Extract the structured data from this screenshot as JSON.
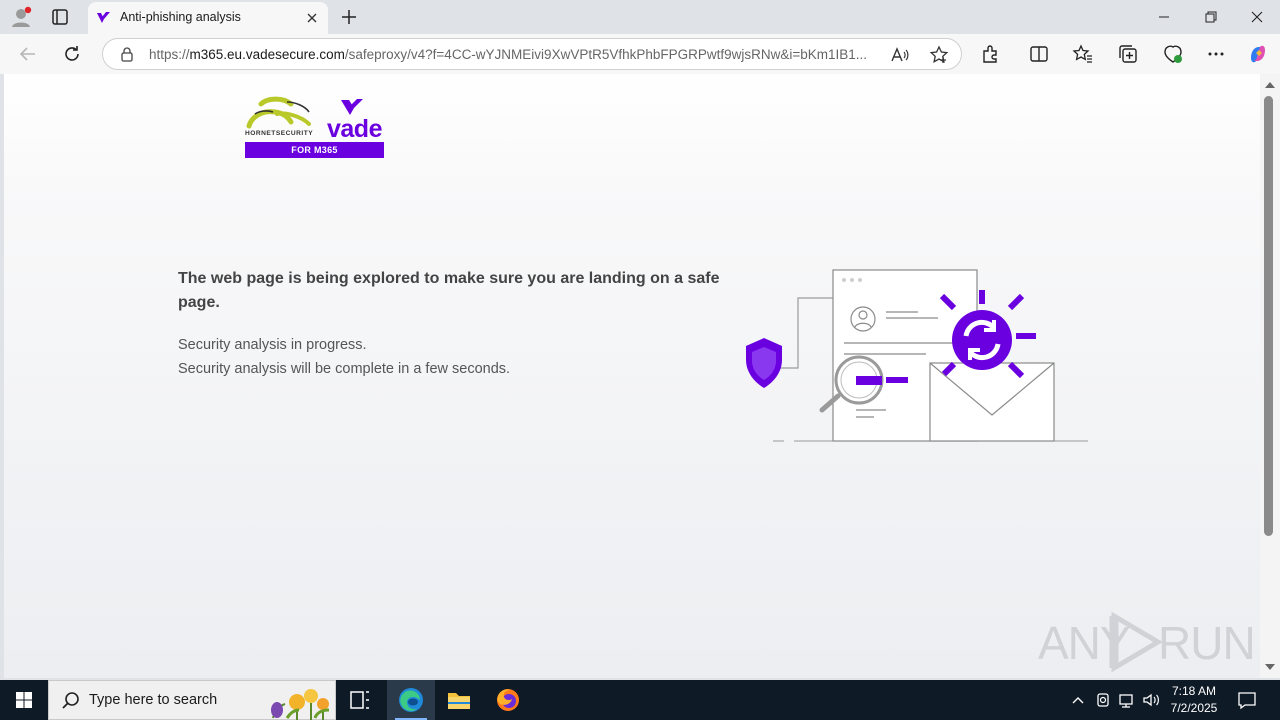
{
  "browser": {
    "tab": {
      "title": "Anti-phishing analysis"
    },
    "address": {
      "scheme": "https://",
      "host": "m365.eu.vadesecure.com",
      "rest": "/safeproxy/v4?f=4CC-wYJNMEivi9XwVPtR5VfhkPhbFPGRPwtf9wjsRNw&i=bKm1IB1..."
    }
  },
  "page": {
    "logo": {
      "hornet_text": "HORNETSECURITY",
      "vade_text": "vade",
      "band_prefix": "FOR",
      "band_product": "M365"
    },
    "headline": "The web page is being explored to make sure you are landing on a safe page.",
    "status_line1": "Security analysis in progress.",
    "status_line2": "Security analysis will be complete in a few seconds."
  },
  "watermark": {
    "left": "ANY",
    "right": "RUN"
  },
  "taskbar": {
    "search_placeholder": "Type here to search",
    "time": "7:18 AM",
    "date": "7/2/2025"
  },
  "colors": {
    "brand_purple": "#6a00e0",
    "hornet_green": "#b9c92a",
    "taskbar": "#0e1a26"
  }
}
